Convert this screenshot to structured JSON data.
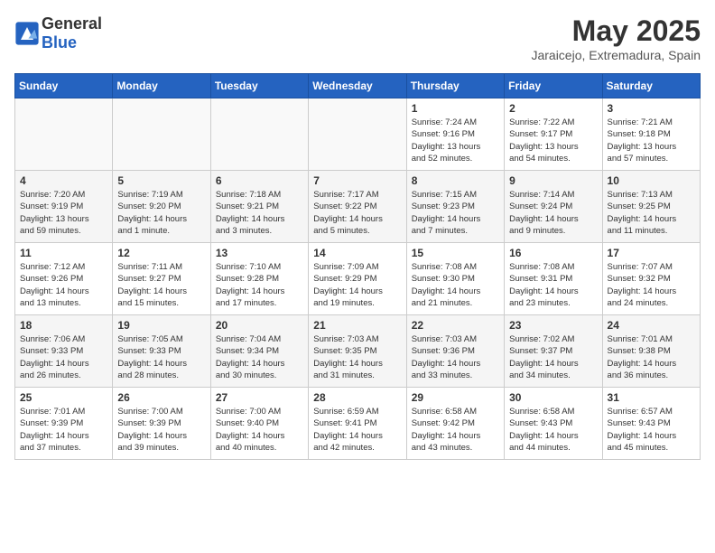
{
  "header": {
    "logo_general": "General",
    "logo_blue": "Blue",
    "month_year": "May 2025",
    "location": "Jaraicejo, Extremadura, Spain"
  },
  "weekdays": [
    "Sunday",
    "Monday",
    "Tuesday",
    "Wednesday",
    "Thursday",
    "Friday",
    "Saturday"
  ],
  "weeks": [
    [
      {
        "day": "",
        "info": ""
      },
      {
        "day": "",
        "info": ""
      },
      {
        "day": "",
        "info": ""
      },
      {
        "day": "",
        "info": ""
      },
      {
        "day": "1",
        "info": "Sunrise: 7:24 AM\nSunset: 9:16 PM\nDaylight: 13 hours\nand 52 minutes."
      },
      {
        "day": "2",
        "info": "Sunrise: 7:22 AM\nSunset: 9:17 PM\nDaylight: 13 hours\nand 54 minutes."
      },
      {
        "day": "3",
        "info": "Sunrise: 7:21 AM\nSunset: 9:18 PM\nDaylight: 13 hours\nand 57 minutes."
      }
    ],
    [
      {
        "day": "4",
        "info": "Sunrise: 7:20 AM\nSunset: 9:19 PM\nDaylight: 13 hours\nand 59 minutes."
      },
      {
        "day": "5",
        "info": "Sunrise: 7:19 AM\nSunset: 9:20 PM\nDaylight: 14 hours\nand 1 minute."
      },
      {
        "day": "6",
        "info": "Sunrise: 7:18 AM\nSunset: 9:21 PM\nDaylight: 14 hours\nand 3 minutes."
      },
      {
        "day": "7",
        "info": "Sunrise: 7:17 AM\nSunset: 9:22 PM\nDaylight: 14 hours\nand 5 minutes."
      },
      {
        "day": "8",
        "info": "Sunrise: 7:15 AM\nSunset: 9:23 PM\nDaylight: 14 hours\nand 7 minutes."
      },
      {
        "day": "9",
        "info": "Sunrise: 7:14 AM\nSunset: 9:24 PM\nDaylight: 14 hours\nand 9 minutes."
      },
      {
        "day": "10",
        "info": "Sunrise: 7:13 AM\nSunset: 9:25 PM\nDaylight: 14 hours\nand 11 minutes."
      }
    ],
    [
      {
        "day": "11",
        "info": "Sunrise: 7:12 AM\nSunset: 9:26 PM\nDaylight: 14 hours\nand 13 minutes."
      },
      {
        "day": "12",
        "info": "Sunrise: 7:11 AM\nSunset: 9:27 PM\nDaylight: 14 hours\nand 15 minutes."
      },
      {
        "day": "13",
        "info": "Sunrise: 7:10 AM\nSunset: 9:28 PM\nDaylight: 14 hours\nand 17 minutes."
      },
      {
        "day": "14",
        "info": "Sunrise: 7:09 AM\nSunset: 9:29 PM\nDaylight: 14 hours\nand 19 minutes."
      },
      {
        "day": "15",
        "info": "Sunrise: 7:08 AM\nSunset: 9:30 PM\nDaylight: 14 hours\nand 21 minutes."
      },
      {
        "day": "16",
        "info": "Sunrise: 7:08 AM\nSunset: 9:31 PM\nDaylight: 14 hours\nand 23 minutes."
      },
      {
        "day": "17",
        "info": "Sunrise: 7:07 AM\nSunset: 9:32 PM\nDaylight: 14 hours\nand 24 minutes."
      }
    ],
    [
      {
        "day": "18",
        "info": "Sunrise: 7:06 AM\nSunset: 9:33 PM\nDaylight: 14 hours\nand 26 minutes."
      },
      {
        "day": "19",
        "info": "Sunrise: 7:05 AM\nSunset: 9:33 PM\nDaylight: 14 hours\nand 28 minutes."
      },
      {
        "day": "20",
        "info": "Sunrise: 7:04 AM\nSunset: 9:34 PM\nDaylight: 14 hours\nand 30 minutes."
      },
      {
        "day": "21",
        "info": "Sunrise: 7:03 AM\nSunset: 9:35 PM\nDaylight: 14 hours\nand 31 minutes."
      },
      {
        "day": "22",
        "info": "Sunrise: 7:03 AM\nSunset: 9:36 PM\nDaylight: 14 hours\nand 33 minutes."
      },
      {
        "day": "23",
        "info": "Sunrise: 7:02 AM\nSunset: 9:37 PM\nDaylight: 14 hours\nand 34 minutes."
      },
      {
        "day": "24",
        "info": "Sunrise: 7:01 AM\nSunset: 9:38 PM\nDaylight: 14 hours\nand 36 minutes."
      }
    ],
    [
      {
        "day": "25",
        "info": "Sunrise: 7:01 AM\nSunset: 9:39 PM\nDaylight: 14 hours\nand 37 minutes."
      },
      {
        "day": "26",
        "info": "Sunrise: 7:00 AM\nSunset: 9:39 PM\nDaylight: 14 hours\nand 39 minutes."
      },
      {
        "day": "27",
        "info": "Sunrise: 7:00 AM\nSunset: 9:40 PM\nDaylight: 14 hours\nand 40 minutes."
      },
      {
        "day": "28",
        "info": "Sunrise: 6:59 AM\nSunset: 9:41 PM\nDaylight: 14 hours\nand 42 minutes."
      },
      {
        "day": "29",
        "info": "Sunrise: 6:58 AM\nSunset: 9:42 PM\nDaylight: 14 hours\nand 43 minutes."
      },
      {
        "day": "30",
        "info": "Sunrise: 6:58 AM\nSunset: 9:43 PM\nDaylight: 14 hours\nand 44 minutes."
      },
      {
        "day": "31",
        "info": "Sunrise: 6:57 AM\nSunset: 9:43 PM\nDaylight: 14 hours\nand 45 minutes."
      }
    ]
  ]
}
